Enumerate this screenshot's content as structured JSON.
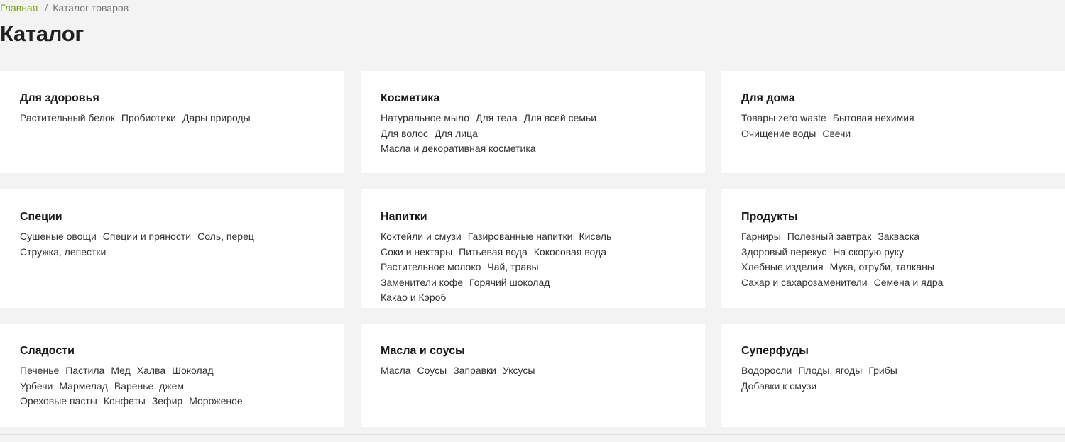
{
  "breadcrumb": {
    "home": "Главная",
    "separator": "/",
    "current": "Каталог товаров"
  },
  "page_title": "Каталог",
  "colors": {
    "background": "#f3f3f3",
    "card": "#ffffff",
    "accent_link": "#7aa21c",
    "text": "#222222"
  },
  "categories": [
    {
      "title": "Для здоровья",
      "links": [
        "Растительный белок",
        "Пробиотики",
        "Дары природы"
      ]
    },
    {
      "title": "Косметика",
      "links": [
        "Натуральное мыло",
        "Для тела",
        "Для всей семьи",
        "Для волос",
        "Для лица",
        "Масла и декоративная косметика"
      ]
    },
    {
      "title": "Для дома",
      "links": [
        "Товары zero waste",
        "Бытовая нехимия",
        "Очищение воды",
        "Свечи"
      ]
    },
    {
      "title": "Специи",
      "links": [
        "Сушеные овощи",
        "Специи и пряности",
        "Соль, перец",
        "Стружка, лепестки"
      ]
    },
    {
      "title": "Напитки",
      "links": [
        "Коктейли и смузи",
        "Газированные напитки",
        "Кисель",
        "Соки и нектары",
        "Питьевая вода",
        "Кокосовая вода",
        "Растительное молоко",
        "Чай, травы",
        "Заменители кофе",
        "Горячий шоколад",
        "Какао и Кэроб"
      ]
    },
    {
      "title": "Продукты",
      "links": [
        "Гарниры",
        "Полезный завтрак",
        "Закваска",
        "Здоровый перекус",
        "На скорую руку",
        "Хлебные изделия",
        "Мука, отруби, талканы",
        "Сахар и сахарозаменители",
        "Семена и ядра"
      ]
    },
    {
      "title": "Сладости",
      "links": [
        "Печенье",
        "Пастила",
        "Мед",
        "Халва",
        "Шоколад",
        "Урбечи",
        "Мармелад",
        "Варенье, джем",
        "Ореховые пасты",
        "Конфеты",
        "Зефир",
        "Мороженое"
      ]
    },
    {
      "title": "Масла и соусы",
      "links": [
        "Масла",
        "Соусы",
        "Заправки",
        "Уксусы"
      ]
    },
    {
      "title": "Суперфуды",
      "links": [
        "Водоросли",
        "Плоды, ягоды",
        "Грибы",
        "Добавки к смузи"
      ]
    }
  ]
}
